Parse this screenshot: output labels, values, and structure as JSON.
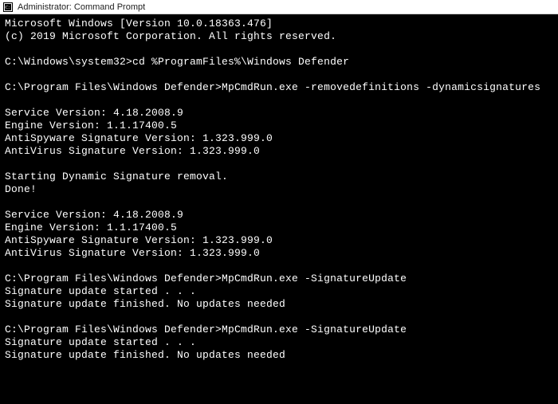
{
  "titlebar": {
    "title": "Administrator: Command Prompt"
  },
  "terminal": {
    "lines": [
      "Microsoft Windows [Version 10.0.18363.476]",
      "(c) 2019 Microsoft Corporation. All rights reserved.",
      "",
      "C:\\Windows\\system32>cd %ProgramFiles%\\Windows Defender",
      "",
      "C:\\Program Files\\Windows Defender>MpCmdRun.exe -removedefinitions -dynamicsignatures",
      "",
      "Service Version: 4.18.2008.9",
      "Engine Version: 1.1.17400.5",
      "AntiSpyware Signature Version: 1.323.999.0",
      "AntiVirus Signature Version: 1.323.999.0",
      "",
      "Starting Dynamic Signature removal.",
      "Done!",
      "",
      "Service Version: 4.18.2008.9",
      "Engine Version: 1.1.17400.5",
      "AntiSpyware Signature Version: 1.323.999.0",
      "AntiVirus Signature Version: 1.323.999.0",
      "",
      "C:\\Program Files\\Windows Defender>MpCmdRun.exe -SignatureUpdate",
      "Signature update started . . .",
      "Signature update finished. No updates needed",
      "",
      "C:\\Program Files\\Windows Defender>MpCmdRun.exe -SignatureUpdate",
      "Signature update started . . .",
      "Signature update finished. No updates needed"
    ]
  }
}
